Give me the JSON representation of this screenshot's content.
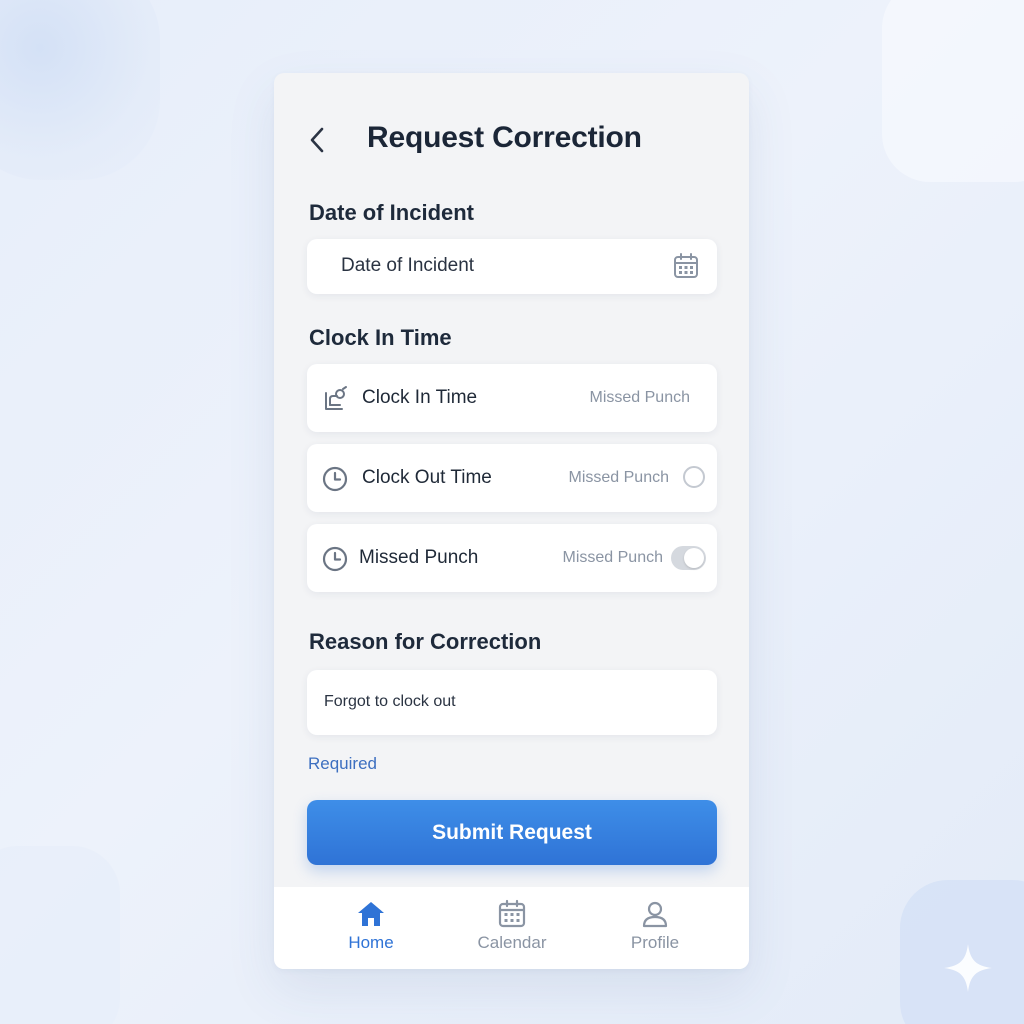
{
  "header": {
    "title": "Request Correction"
  },
  "date_section": {
    "label": "Date of Incident",
    "field_text": "Date of Incident"
  },
  "clock_section": {
    "label": "Clock In Time",
    "rows": [
      {
        "label": "Clock In Time",
        "status": "Missed Punch",
        "control": "none"
      },
      {
        "label": "Clock Out Time",
        "status": "Missed Punch",
        "control": "radio",
        "selected": false
      },
      {
        "label": "Missed Punch",
        "status": "Missed Punch",
        "control": "toggle",
        "on": false
      }
    ]
  },
  "reason_section": {
    "label": "Reason for Correction",
    "value": "Forgot to clock out",
    "hint": "Required"
  },
  "submit": {
    "label": "Submit Request"
  },
  "nav": {
    "items": [
      {
        "label": "Home",
        "icon": "home-icon",
        "active": true
      },
      {
        "label": "Calendar",
        "icon": "calendar-icon",
        "active": false
      },
      {
        "label": "Profile",
        "icon": "profile-icon",
        "active": false
      }
    ]
  },
  "colors": {
    "accent": "#2f73d6",
    "title": "#1b2637",
    "muted": "#8a94a3",
    "background": "#e9eff9"
  }
}
